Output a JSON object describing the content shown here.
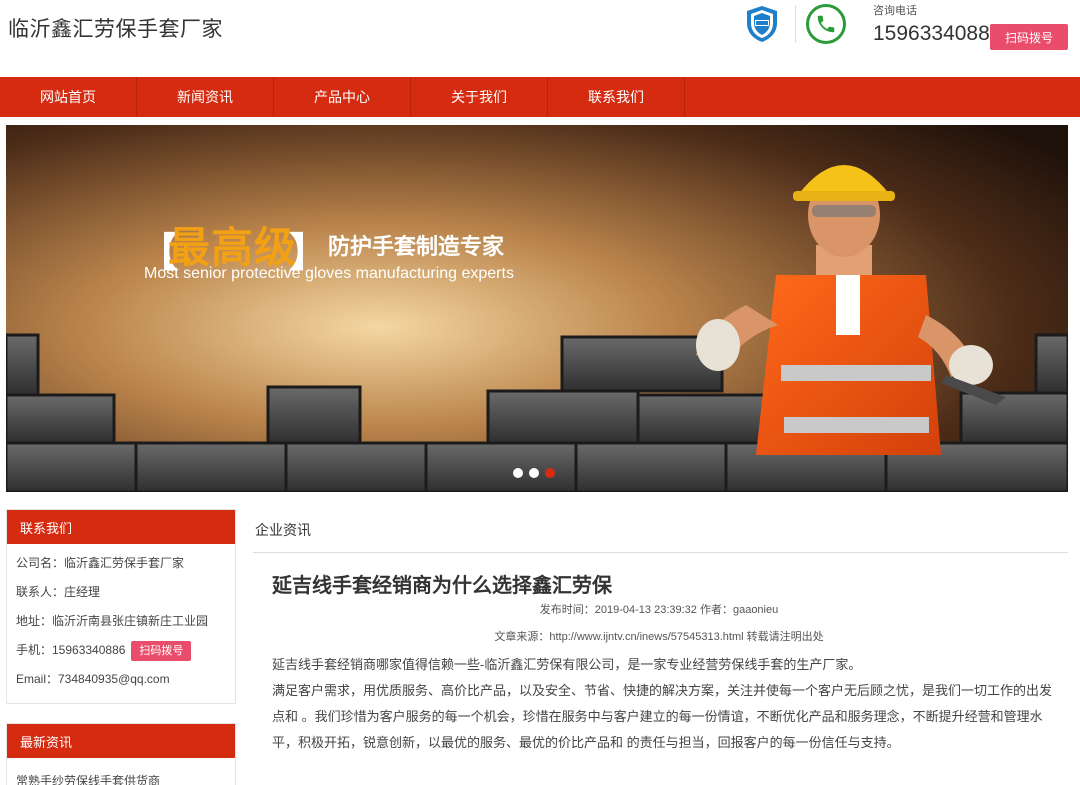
{
  "header": {
    "site_title": "临沂鑫汇劳保手套厂家",
    "hotline_label": "咨询电话",
    "hotline_number": "15963340886",
    "scan_button": "扫码拨号",
    "shield_icon": "integrity-shield-icon",
    "phone_icon": "phone-icon"
  },
  "nav": {
    "items": [
      "网站首页",
      "新闻资讯",
      "产品中心",
      "关于我们",
      "联系我们"
    ]
  },
  "banner": {
    "bracket_left": "【",
    "headline": "最高级",
    "bracket_right": "】",
    "tagline": "防护手套制造专家",
    "tagline_en": "Most senior protective gloves manufacturing experts",
    "slides_total": 3,
    "active_slide": 3
  },
  "sidebar": {
    "contact": {
      "title": "联系我们",
      "company": "公司名：临沂鑫汇劳保手套厂家",
      "contact_person": "联系人：庄经理",
      "address": "地址：临沂沂南县张庄镇新庄工业园",
      "mobile": "手机：15963340886",
      "scan_button": "扫码拨号",
      "email": "Email：734840935@qq.com"
    },
    "news": {
      "title": "最新资讯",
      "first_item": "常熟手纱劳保线手套供货商"
    }
  },
  "main": {
    "breadcrumb": "企业资讯",
    "article": {
      "title": "延吉线手套经销商为什么选择鑫汇劳保",
      "meta_time": "发布时间：2019-04-13 23:39:32 作者：gaaonieu",
      "meta_source": "文章来源：http://www.ijntv.cn/inews/57545313.html 转载请注明出处",
      "paragraphs": [
        "延吉线手套经销商哪家值得信赖一些-临沂鑫汇劳保有限公司，是一家专业经营劳保线手套的生产厂家。",
        "满足客户需求，用优质服务、高价比产品，以及安全、节省、快捷的解决方案，关注并使每一个客户无后顾之忧，是我们一切工作的出发点和 。我们珍惜为客户服务的每一个机会，珍惜在服务中与客户建立的每一份情谊，不断优化产品和服务理念，不断提升经营和管理水平，积极开拓，锐意创新，以最优的服务、最优的价比产品和 的责任与担当，回报客户的每一份信任与支持。"
      ]
    }
  },
  "colors": {
    "nav_red": "#d42b11",
    "button_pink": "#ea4c6b",
    "headline_orange": "#f2a014"
  }
}
